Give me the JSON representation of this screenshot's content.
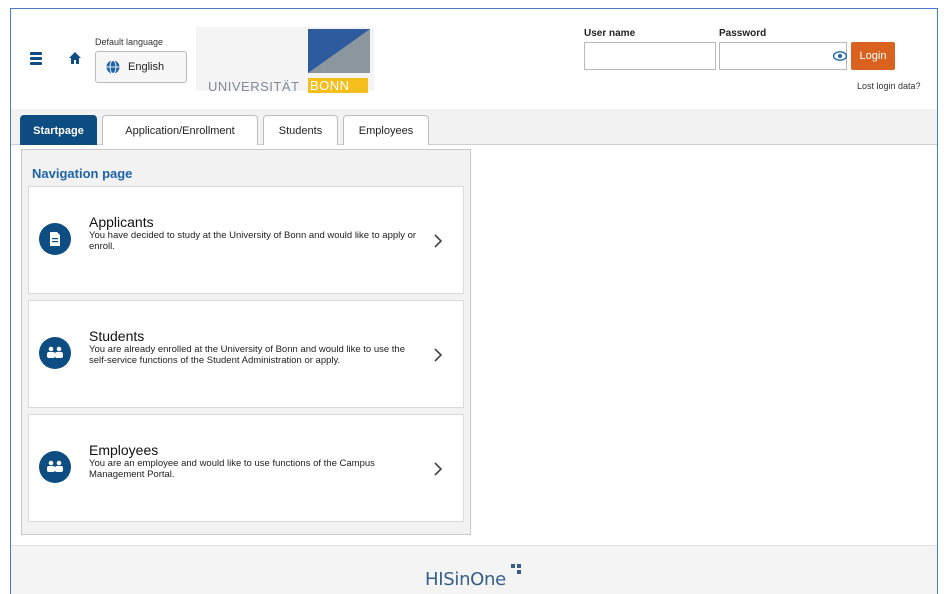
{
  "header": {
    "language_label": "Default language",
    "language_value": "English",
    "logo_text": "UNIVERSITÄT",
    "logo_highlight": "BONN",
    "username_label": "User name",
    "username_value": "",
    "password_label": "Password",
    "password_value": "",
    "login_button": "Login",
    "lost_login": "Lost login data?"
  },
  "tabs": [
    {
      "label": "Startpage",
      "active": true
    },
    {
      "label": "Application/Enrollment",
      "active": false
    },
    {
      "label": "Students",
      "active": false
    },
    {
      "label": "Employees",
      "active": false
    }
  ],
  "navigation": {
    "title": "Navigation page",
    "cards": [
      {
        "title": "Applicants",
        "description": "You have decided to study at the University of Bonn and would like to apply or enroll.",
        "icon": "document-icon"
      },
      {
        "title": "Students",
        "description": "You are already enrolled at the University of Bonn and would like to use the self-service functions of the Student Administration or apply.",
        "icon": "people-icon"
      },
      {
        "title": "Employees",
        "description": "You are an employee and would like to use functions of the Campus Management Portal.",
        "icon": "people-icon"
      }
    ]
  },
  "footer": {
    "brand": "HISinOne"
  },
  "colors": {
    "primary": "#0e4d81",
    "login_button": "#d9621f",
    "link_title": "#1d63a6",
    "logo_yellow": "#f4bf1d"
  }
}
